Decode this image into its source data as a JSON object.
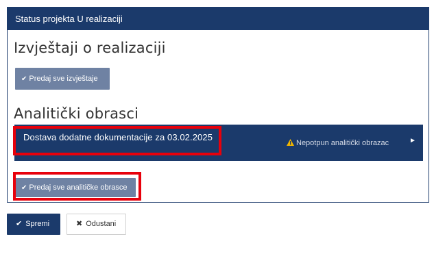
{
  "panel": {
    "header_title": "Status projekta U realizaciji",
    "reports_title": "Izvještaji o realizaciji",
    "submit_reports_label": "Predaj sve izvještaje",
    "forms_title": "Analitički obrasci",
    "form_row": {
      "title": "Dostava dodatne dokumentacije za 03.02.2025",
      "status": "Nepotpun analitički obrazac"
    },
    "submit_forms_label": "Predaj sve analitičke obrasce"
  },
  "actions": {
    "save_label": "Spremi",
    "cancel_label": "Odustani"
  },
  "icons": {
    "check": "check-icon",
    "warning": "warning-icon",
    "chevron": "chevron-right-icon",
    "close": "close-icon"
  },
  "colors": {
    "primary": "#1b3a6b",
    "button_grey": "#6f82a3",
    "highlight": "#e8000b",
    "warning": "#f0b400"
  }
}
